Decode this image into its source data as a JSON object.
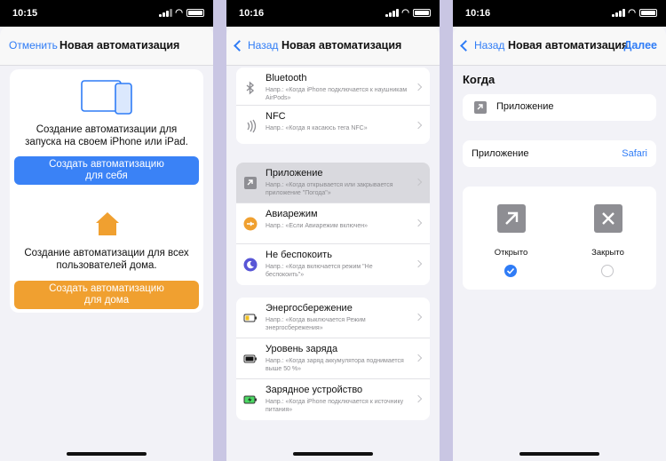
{
  "screen1": {
    "time": "10:15",
    "nav": {
      "cancel": "Отменить",
      "title": "Новая автоматизация"
    },
    "personal": {
      "description": "Создание автоматизации для запуска на своем iPhone или iPad.",
      "button_line1": "Создать автоматизацию",
      "button_line2": "для себя",
      "icon": "devices-icon",
      "button_color": "#3a82f6"
    },
    "home": {
      "description": "Создание автоматизации для всех пользователей дома.",
      "button_line1": "Создать автоматизацию",
      "button_line2": "для дома",
      "icon": "home-icon",
      "button_color": "#f0a030"
    }
  },
  "screen2": {
    "time": "10:16",
    "nav": {
      "back": "Назад",
      "title": "Новая автоматизация"
    },
    "group1": [
      {
        "title": "Bluetooth",
        "subtitle": "Напр.: «Когда iPhone подключается к наушникам AirPods»",
        "icon": "bluetooth-icon"
      },
      {
        "title": "NFC",
        "subtitle": "Напр.: «Когда я касаюсь тега NFC»",
        "icon": "nfc-icon"
      }
    ],
    "group2": [
      {
        "title": "Приложение",
        "subtitle": "Напр.: «Когда открывается или закрывается приложение \"Погода\"»",
        "icon": "app-arrow-icon"
      },
      {
        "title": "Авиарежим",
        "subtitle": "Напр.: «Если Авиарежим включен»",
        "icon": "airplane-icon"
      },
      {
        "title": "Не беспокоить",
        "subtitle": "Напр.: «Когда включается режим \"Не беспокоить\"»",
        "icon": "moon-icon"
      }
    ],
    "group3": [
      {
        "title": "Энергосбережение",
        "subtitle": "Напр.: «Когда выключается Режим энергосбережения»",
        "icon": "low-battery-icon"
      },
      {
        "title": "Уровень заряда",
        "subtitle": "Напр.: «Когда заряд аккумулятора поднимается выше 50 %»",
        "icon": "battery-level-icon"
      },
      {
        "title": "Зарядное устройство",
        "subtitle": "Напр.: «Когда iPhone подключается к источнику питания»",
        "icon": "charging-icon"
      }
    ]
  },
  "screen3": {
    "time": "10:16",
    "nav": {
      "back": "Назад",
      "title": "Новая автоматизация",
      "next": "Далее"
    },
    "section_title": "Когда",
    "trigger_label": "Приложение",
    "app_row": {
      "label": "Приложение",
      "value": "Safari"
    },
    "open": {
      "label": "Открыто",
      "selected": true
    },
    "closed": {
      "label": "Закрыто",
      "selected": false
    }
  }
}
